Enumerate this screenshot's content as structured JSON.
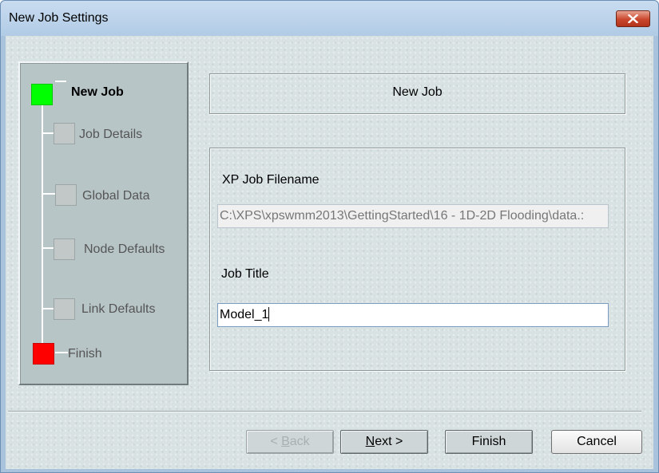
{
  "window": {
    "title": "New Job Settings",
    "close_icon": "close-x-icon"
  },
  "steps": [
    {
      "label": "New Job",
      "status": "current",
      "color": "#00ff00"
    },
    {
      "label": "Job Details",
      "status": "pending",
      "color": "#c2c7c8"
    },
    {
      "label": "Global Data",
      "status": "pending",
      "color": "#c2c7c8"
    },
    {
      "label": "Node Defaults",
      "status": "pending",
      "color": "#c2c7c8"
    },
    {
      "label": "Link Defaults",
      "status": "pending",
      "color": "#c2c7c8"
    },
    {
      "label": "Finish",
      "status": "final",
      "color": "#ff0000"
    }
  ],
  "header": {
    "title": "New Job"
  },
  "form": {
    "filename_label": "XP Job Filename",
    "filename_value": "C:\\XPS\\xpswmm2013\\GettingStarted\\16 - 1D-2D Flooding\\data.:",
    "job_title_label": "Job Title",
    "job_title_value": "Model_1"
  },
  "buttons": {
    "back": {
      "mnemonic": "B",
      "rest": "ack",
      "prefix": "< ",
      "enabled": false
    },
    "next": {
      "mnemonic": "N",
      "rest": "ext >",
      "enabled": true
    },
    "finish": {
      "label": "Finish",
      "enabled": true
    },
    "cancel": {
      "label": "Cancel",
      "enabled": true
    }
  }
}
